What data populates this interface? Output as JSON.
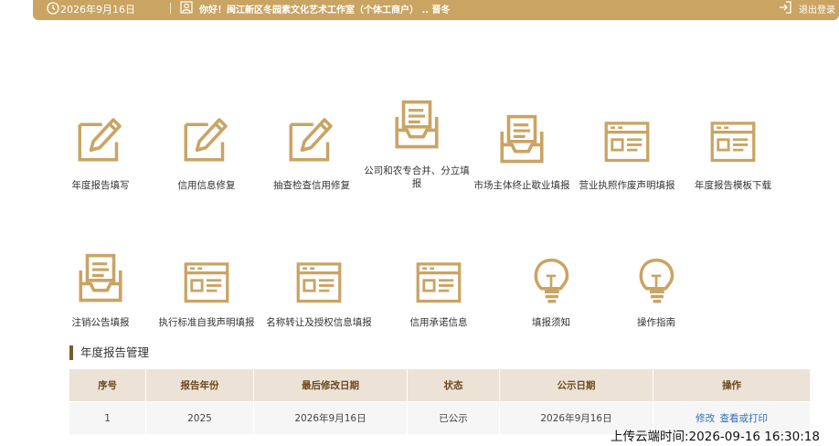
{
  "topbar": {
    "date": "2026年9月16日",
    "greeting": "你好！闽江新区冬园素文化艺术工作室（个体工商户）  .. 晋冬",
    "logout": "退出登录"
  },
  "tiles": [
    {
      "label": "年度报告填写",
      "icon": "edit-icon"
    },
    {
      "label": "信用信息修复",
      "icon": "edit-icon"
    },
    {
      "label": "抽查检查信用修复",
      "icon": "edit-icon"
    },
    {
      "label": "公司和农专合并、分立填报",
      "icon": "tray-icon"
    },
    {
      "label": "市场主体终止歇业填报",
      "icon": "tray-icon"
    },
    {
      "label": "营业执照作废声明填报",
      "icon": "window-icon"
    },
    {
      "label": "年度报告模板下载",
      "icon": "window-icon"
    },
    {
      "label": "注销公告填报",
      "icon": "tray-icon"
    },
    {
      "label": "执行标准自我声明填报",
      "icon": "window-icon"
    },
    {
      "label": "名称转让及授权信息填报",
      "icon": "window-icon"
    },
    {
      "label": "信用承诺信息",
      "icon": "window-icon"
    },
    {
      "label": "填报须知",
      "icon": "bulb-icon"
    },
    {
      "label": "操作指南",
      "icon": "bulb-icon"
    }
  ],
  "section": {
    "title": "年度报告管理"
  },
  "table": {
    "headers": [
      "序号",
      "报告年份",
      "最后修改日期",
      "状态",
      "公示日期",
      "操作"
    ],
    "rows": [
      {
        "index": "1",
        "year": "2025",
        "modified": "2026年9月16日",
        "status": "已公示",
        "published": "2026年9月16日",
        "actions": [
          "修改",
          "查看或打印"
        ]
      }
    ]
  },
  "footer": {
    "upload_time": "上传云端时间:2026-09-16 16:30:18"
  },
  "colors": {
    "accent": "#c9a463",
    "header_bg": "#ece2d6",
    "link": "#2f6fb3"
  }
}
